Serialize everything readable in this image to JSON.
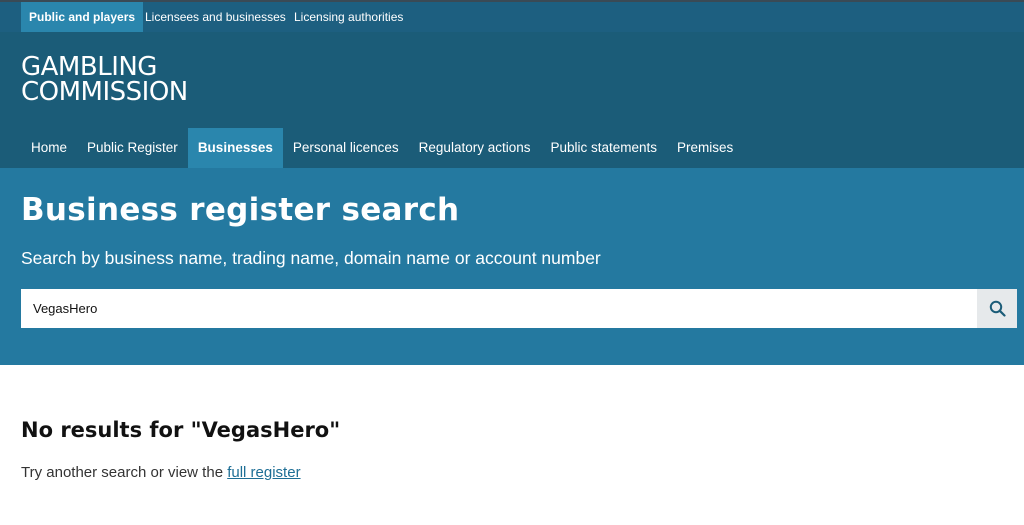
{
  "audience_nav": [
    {
      "label": "Public and players",
      "active": true
    },
    {
      "label": "Licensees and businesses",
      "active": false
    },
    {
      "label": "Licensing authorities",
      "active": false
    }
  ],
  "logo": {
    "line1": "GAMBLING",
    "line2": "COMMISSION"
  },
  "main_nav": [
    {
      "label": "Home",
      "active": false
    },
    {
      "label": "Public Register",
      "active": false
    },
    {
      "label": "Businesses",
      "active": true
    },
    {
      "label": "Personal licences",
      "active": false
    },
    {
      "label": "Regulatory actions",
      "active": false
    },
    {
      "label": "Public statements",
      "active": false
    },
    {
      "label": "Premises",
      "active": false
    }
  ],
  "hero": {
    "title": "Business register search",
    "subtitle": "Search by business name, trading name, domain name or account number"
  },
  "search": {
    "value": "VegasHero",
    "icon": "search-icon"
  },
  "results": {
    "heading": "No results for \"VegasHero\"",
    "hint_prefix": "Try another search or view the ",
    "hint_link": "full register"
  },
  "colors": {
    "top_bar": "#1d5f80",
    "brand_band": "#1b5c78",
    "active_tab": "#2a86ad",
    "hero": "#2479a0",
    "link": "#1d6e95"
  }
}
